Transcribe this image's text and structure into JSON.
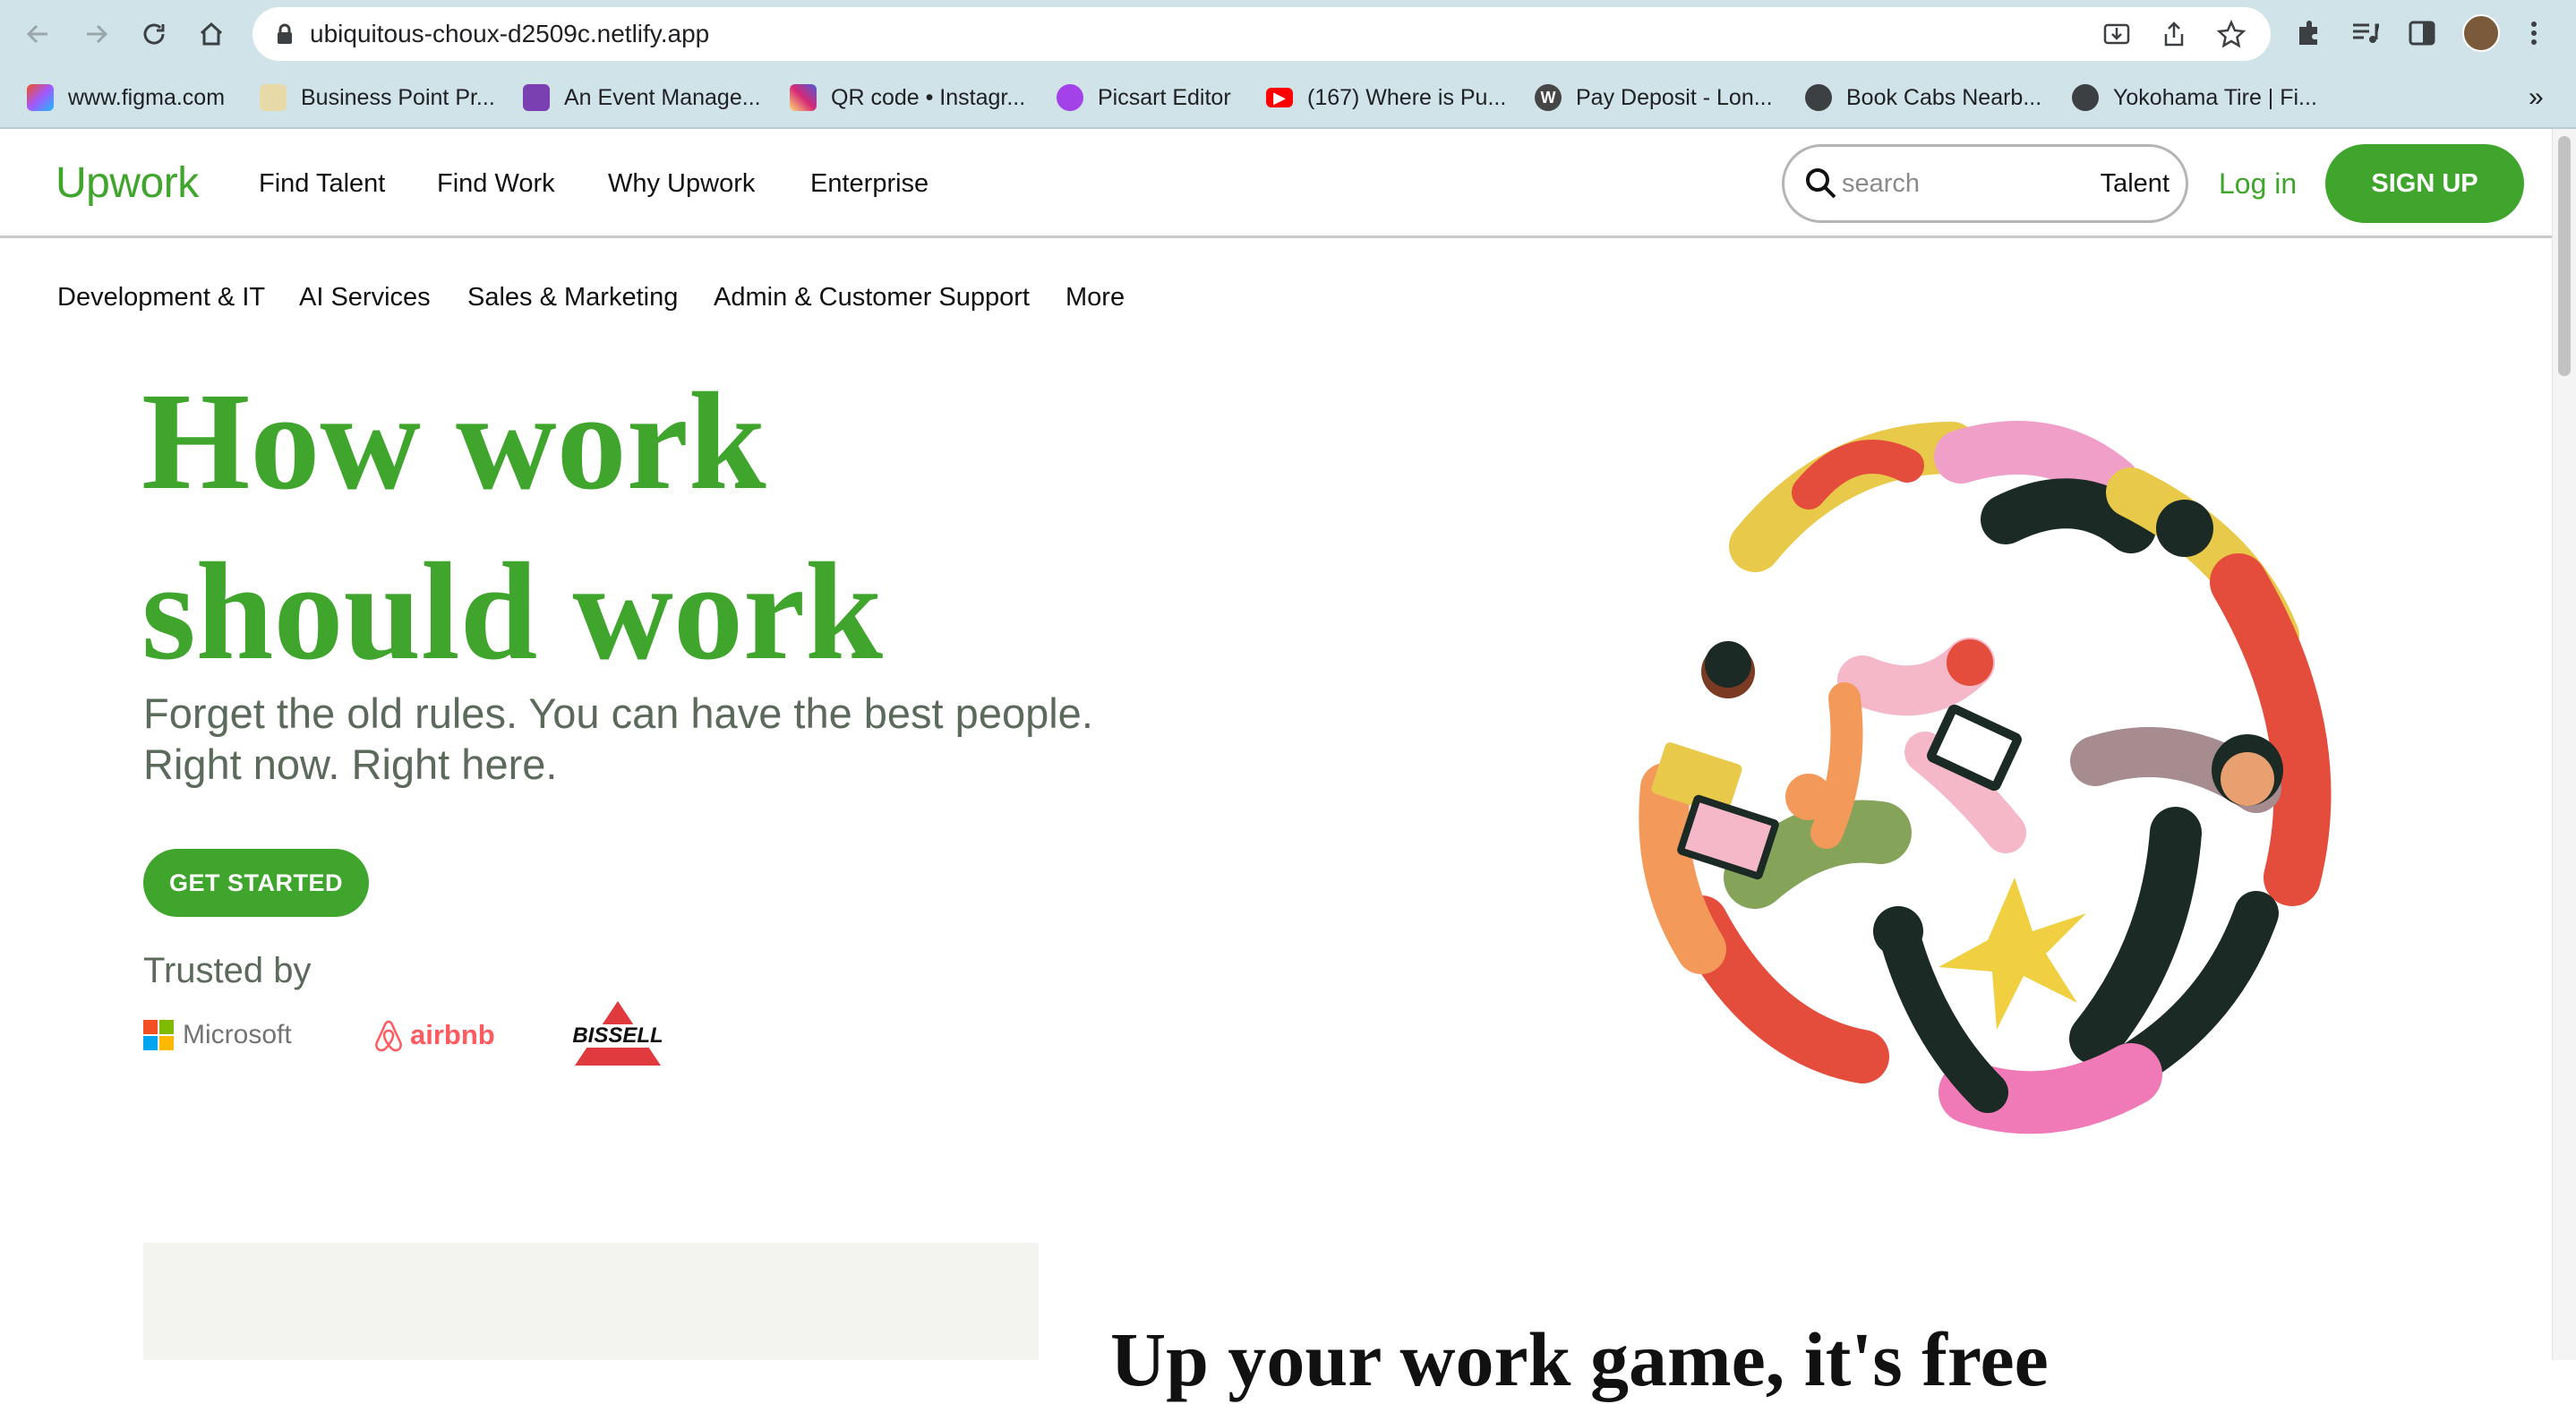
{
  "browser": {
    "url": "ubiquitous-choux-d2509c.netlify.app",
    "bookmarks": [
      {
        "label": "www.figma.com",
        "icon": "figma-icon"
      },
      {
        "label": "Business Point Pr...",
        "icon": "business-icon"
      },
      {
        "label": "An Event Manage...",
        "icon": "event-icon"
      },
      {
        "label": "QR code • Instagr...",
        "icon": "instagram-icon"
      },
      {
        "label": "Picsart Editor",
        "icon": "picsart-icon"
      },
      {
        "label": "(167) Where is Pu...",
        "icon": "youtube-icon"
      },
      {
        "label": "Pay Deposit - Lon...",
        "icon": "wordpress-icon"
      },
      {
        "label": "Book Cabs Nearb...",
        "icon": "globe-icon"
      },
      {
        "label": "Yokohama Tire | Fi...",
        "icon": "globe-icon"
      }
    ],
    "more_bookmarks": "»"
  },
  "header": {
    "logo": "Upwork",
    "nav": [
      "Find Talent",
      "Find Work",
      "Why Upwork",
      "Enterprise"
    ],
    "search_placeholder": "search",
    "search_scope": "Talent",
    "login": "Log in",
    "signup": "SIGN UP"
  },
  "categories": [
    "Development & IT",
    "AI Services",
    "Sales & Marketing",
    "Admin & Customer Support",
    "More"
  ],
  "hero": {
    "title_line1": "How work",
    "title_line2": "should work",
    "subtitle_line1": "Forget the old rules. You can have the best people.",
    "subtitle_line2": "Right now. Right here.",
    "cta": "GET STARTED",
    "trusted_by": "Trusted by",
    "brands": [
      "Microsoft",
      "airbnb",
      "BISSELL"
    ]
  },
  "lower": {
    "title": "Up your work game, it's free"
  },
  "colors": {
    "brand_green": "#3fa52c",
    "subtitle_gray": "#5c6a5b",
    "chrome_bg": "#cfe3e8"
  }
}
